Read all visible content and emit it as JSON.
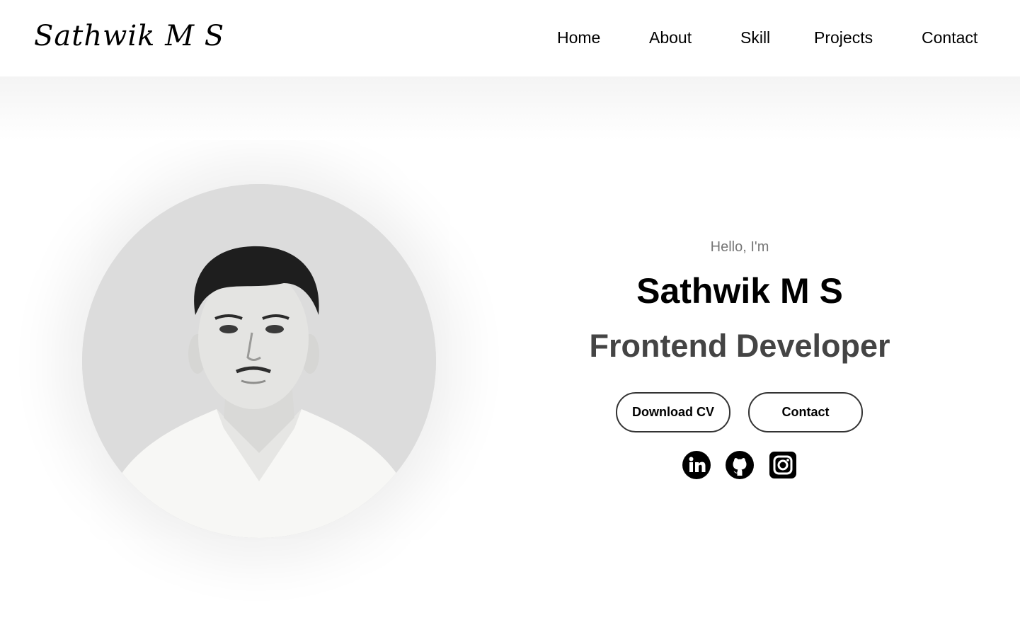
{
  "header": {
    "logo": "Sathwik M S",
    "nav": [
      "Home",
      "About",
      "Skill",
      "Projects",
      "Contact"
    ]
  },
  "hero": {
    "greeting": "Hello, I'm",
    "name": "Sathwik M S",
    "role": "Frontend Developer",
    "buttons": {
      "download_cv": "Download CV",
      "contact": "Contact"
    },
    "socials": [
      "linkedin-icon",
      "github-icon",
      "instagram-icon"
    ]
  },
  "colors": {
    "background": "#ffffff",
    "text": "#000000",
    "greeting": "#777777",
    "role": "#444444",
    "photo_bg": "#dcdcdc"
  }
}
